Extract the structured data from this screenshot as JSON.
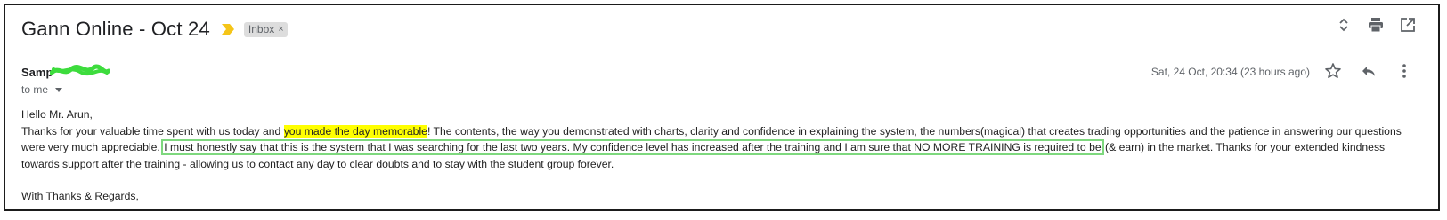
{
  "email": {
    "subject": "Gann Online - Oct 24",
    "label": "Inbox",
    "label_close": "×",
    "sender": "Samp",
    "to": "to me",
    "date": "Sat, 24 Oct, 20:34 (23 hours ago)"
  },
  "icons": {
    "importance": "importance-marker-icon",
    "expand": "expand-collapse-icon",
    "print": "print-icon",
    "open_new": "open-in-new-window-icon",
    "star": "star-icon",
    "reply": "reply-icon",
    "more": "more-vertical-icon",
    "redaction": "redaction-scribble-icon"
  },
  "colors": {
    "highlight_yellow": "#ffff00",
    "highlight_box_green": "#7ed87e",
    "importance_yellow": "#f5c518",
    "redaction_green": "#3ddc3d"
  },
  "body": {
    "greeting": "Hello Mr. Arun,",
    "p1_a": "Thanks for your valuable time spent with us today and ",
    "p1_highlight": "you made the day memorable",
    "p1_b": "! The contents, the way you demonstrated with charts, clarity and confidence in explaining the system, the numbers(magical) that creates trading opportunities and the patience in answering our questions were very much appreciable.",
    "p1_boxed": "I must honestly say that this is the system that I was searching for the last two years. My confidence level has increased after the training and I am sure that NO MORE TRAINING is required to be",
    "p1_c": " (& earn) in the market. Thanks for your extended kindness towards support after the training - allowing us to contact any day to clear doubts and to stay with the student group forever.",
    "closing": "With Thanks & Regards,"
  }
}
